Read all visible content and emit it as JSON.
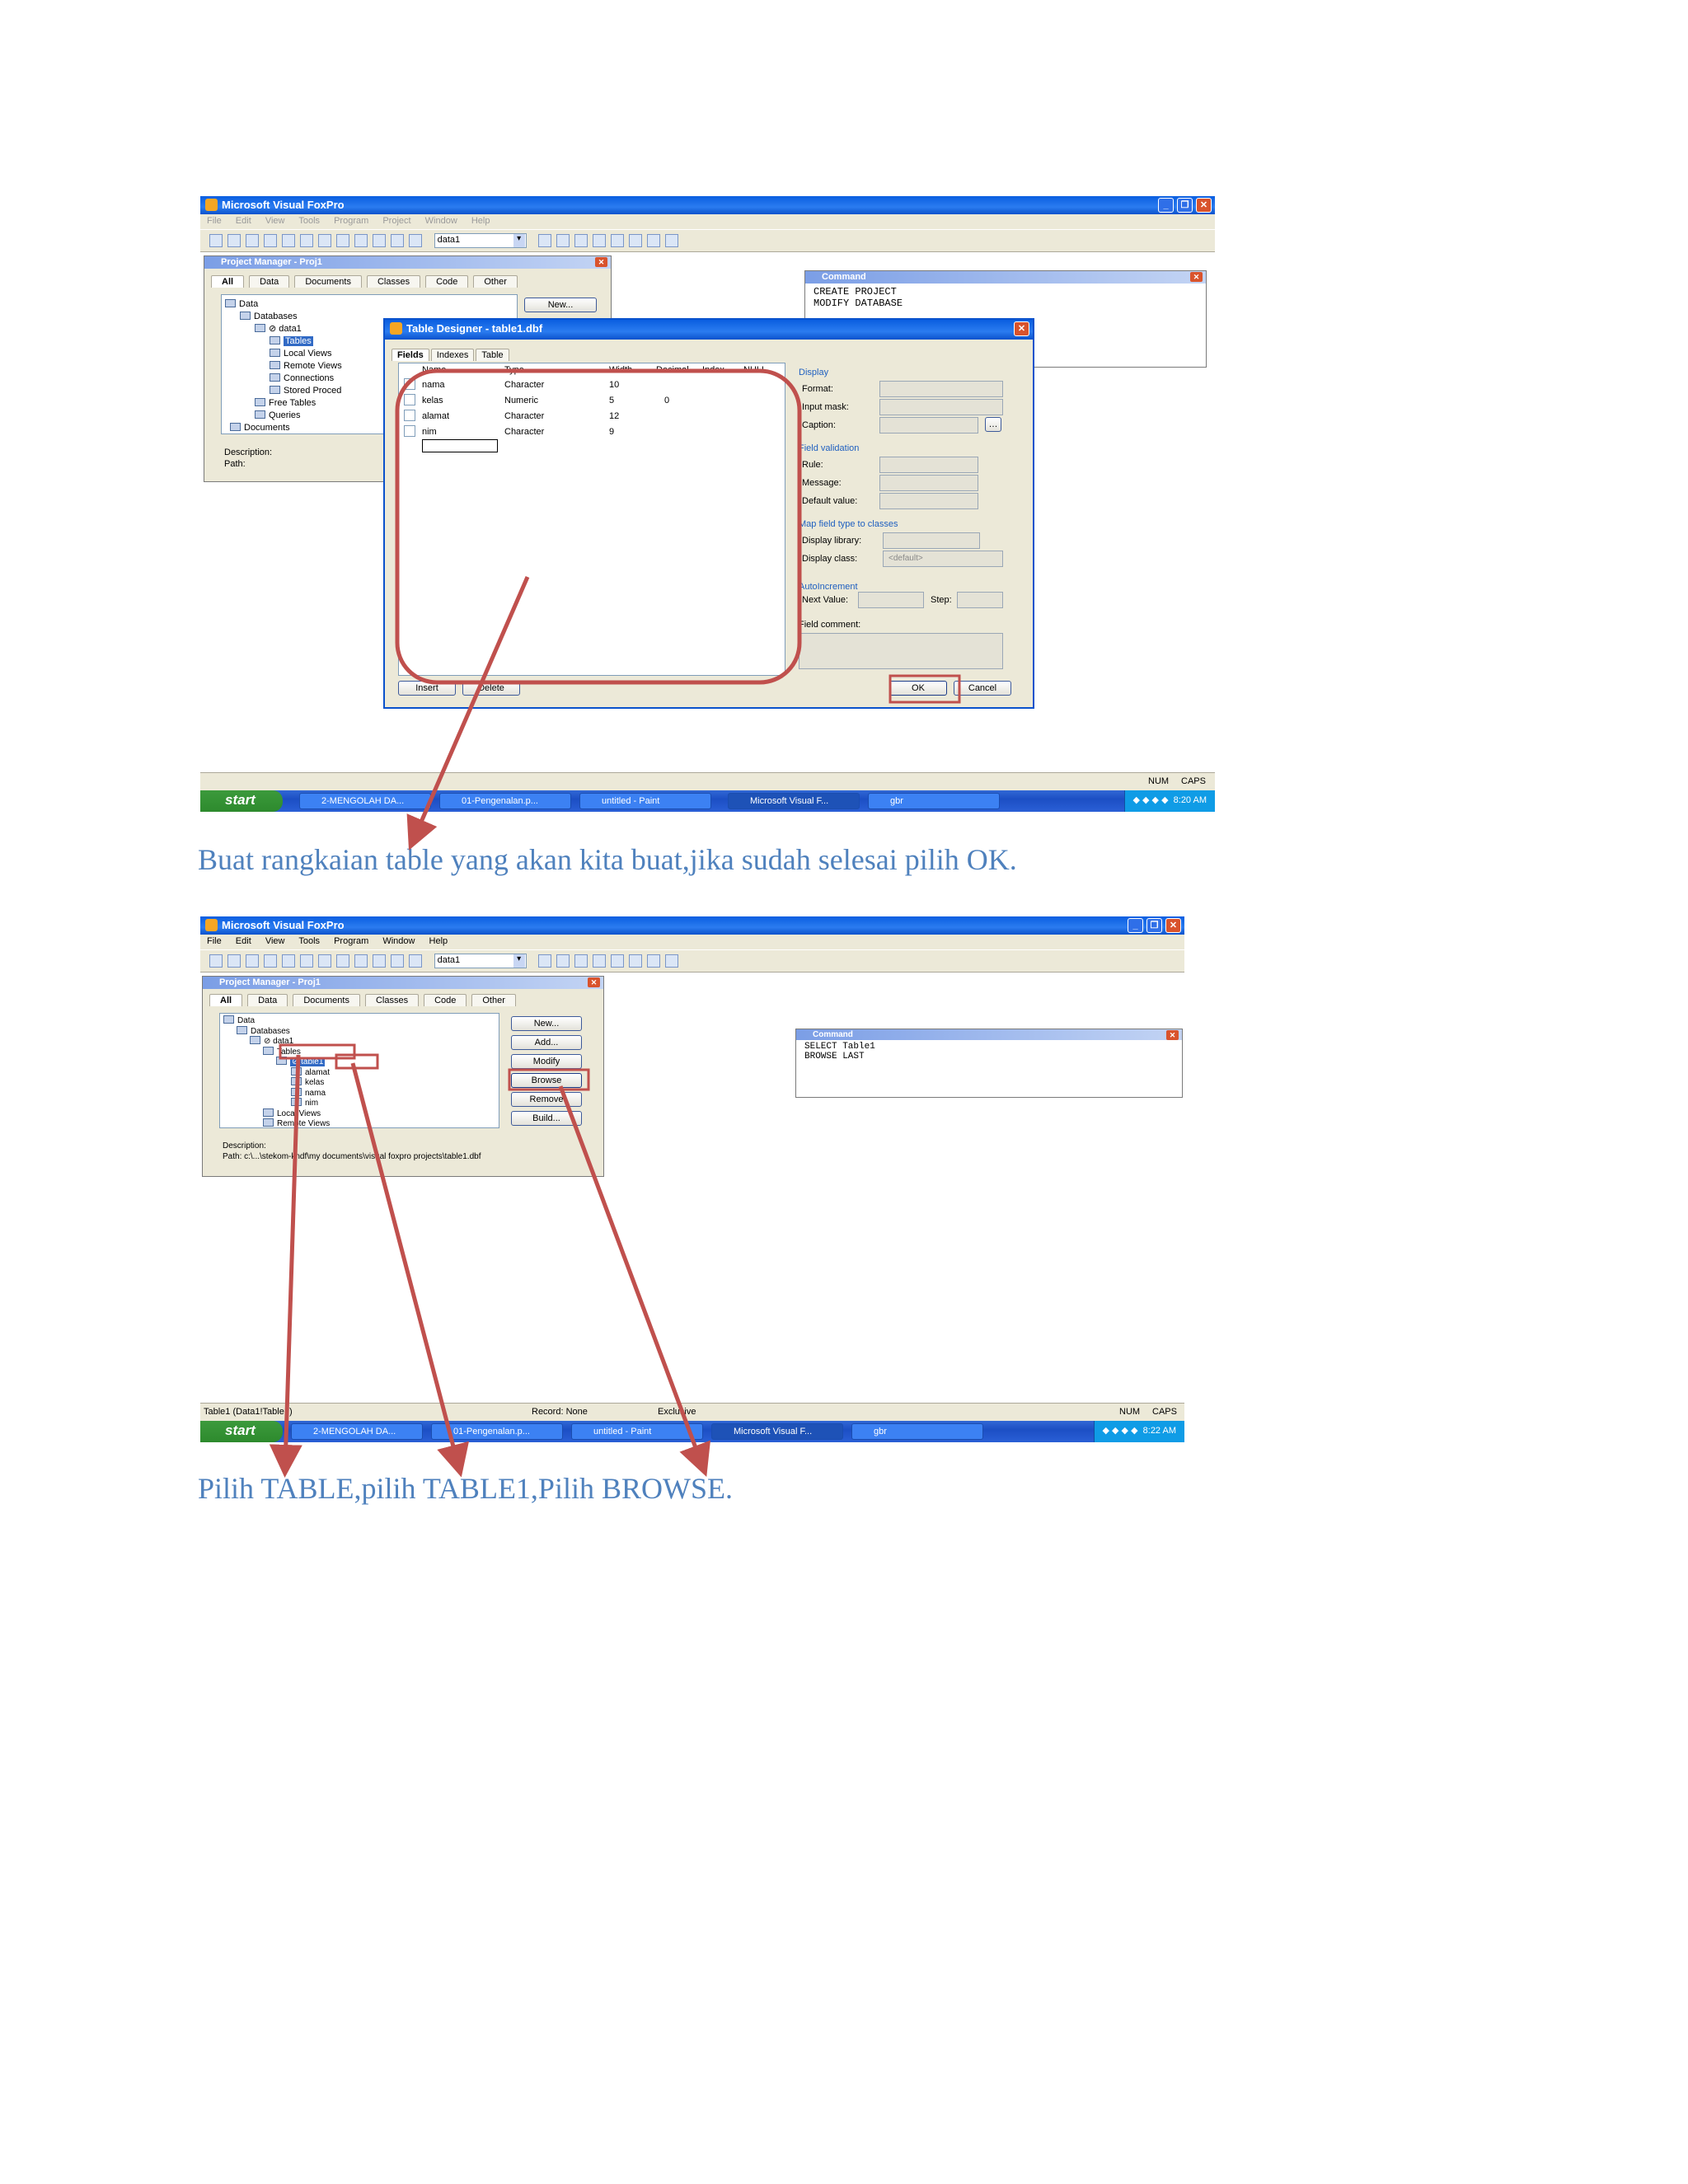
{
  "colors": {
    "annotation": "#c0504d",
    "caption": "#4f81bd",
    "titlebar": "#0a5ee0",
    "selection": "#316ac5"
  },
  "screenshot1": {
    "title": "Microsoft Visual FoxPro",
    "menu": [
      "File",
      "Edit",
      "View",
      "Tools",
      "Program",
      "Project",
      "Window",
      "Help"
    ],
    "toolbar_combo": "data1",
    "project_manager": {
      "title": "Project Manager - Proj1",
      "tabs": [
        "All",
        "Data",
        "Documents",
        "Classes",
        "Code",
        "Other"
      ],
      "tree": [
        "Data",
        "Databases",
        "⊘ data1",
        "Tables",
        "Local Views",
        "Remote Views",
        "Connections",
        "Stored Proced",
        "Free Tables",
        "Queries",
        "Documents"
      ],
      "new_button": "New...",
      "description_label": "Description:",
      "path_label": "Path:"
    },
    "command_window": {
      "title": "Command",
      "lines": [
        "CREATE PROJECT",
        "MODIFY DATABASE"
      ]
    },
    "table_designer": {
      "title": "Table Designer - table1.dbf",
      "tabs": [
        "Fields",
        "Indexes",
        "Table"
      ],
      "columns": [
        "Name",
        "Type",
        "Width",
        "Decimal",
        "Index",
        "NULL"
      ],
      "rows": [
        {
          "name": "nama",
          "type": "Character",
          "width": "10",
          "decimal": ""
        },
        {
          "name": "kelas",
          "type": "Numeric",
          "width": "5",
          "decimal": "0"
        },
        {
          "name": "alamat",
          "type": "Character",
          "width": "12",
          "decimal": ""
        },
        {
          "name": "nim",
          "type": "Character",
          "width": "9",
          "decimal": ""
        }
      ],
      "display_group": "Display",
      "format_label": "Format:",
      "input_mask_label": "Input mask:",
      "caption_label": "Caption:",
      "validation_group": "Field validation",
      "rule_label": "Rule:",
      "message_label": "Message:",
      "default_label": "Default value:",
      "map_group": "Map field type to classes",
      "display_library_label": "Display library:",
      "display_class_label": "Display class:",
      "display_class_value": "<default>",
      "autoinc_group": "AutoIncrement",
      "next_value_label": "Next Value:",
      "step_label": "Step:",
      "field_comment_label": "Field comment:",
      "insert_button": "Insert",
      "delete_button": "Delete",
      "ok_button": "OK",
      "cancel_button": "Cancel"
    },
    "status": {
      "num": "NUM",
      "caps": "CAPS"
    },
    "taskbar": {
      "start": "start",
      "tasks": [
        "2-MENGOLAH DA...",
        "01-Pengenalan.p...",
        "untitled - Paint",
        "Microsoft Visual F...",
        "gbr"
      ],
      "time": "8:20 AM"
    }
  },
  "caption1": "Buat rangkaian table yang akan kita buat,jika sudah selesai pilih OK.",
  "screenshot2": {
    "title": "Microsoft Visual FoxPro",
    "menu": [
      "File",
      "Edit",
      "View",
      "Tools",
      "Program",
      "Window",
      "Help"
    ],
    "toolbar_combo": "data1",
    "project_manager": {
      "title": "Project Manager - Proj1",
      "tabs": [
        "All",
        "Data",
        "Documents",
        "Classes",
        "Code",
        "Other"
      ],
      "tree": [
        "Data",
        "Databases",
        "⊘ data1",
        "Tables",
        "⊘ table1",
        "alamat",
        "kelas",
        "nama",
        "nim",
        "Local Views",
        "Remote Views"
      ],
      "buttons": [
        "New...",
        "Add...",
        "Modify",
        "Browse",
        "Remove",
        "Build..."
      ],
      "description_label": "Description:",
      "path": "Path: c:\\...\\stekom-kndf\\my documents\\visual foxpro projects\\table1.dbf"
    },
    "command_window": {
      "title": "Command",
      "lines": [
        "SELECT Table1",
        "BROWSE LAST"
      ]
    },
    "status": {
      "alias": "Table1 (Data1!Table1)",
      "record": "Record: None",
      "mode": "Exclusive",
      "num": "NUM",
      "caps": "CAPS"
    },
    "taskbar": {
      "start": "start",
      "tasks": [
        "2-MENGOLAH DA...",
        "01-Pengenalan.p...",
        "untitled - Paint",
        "Microsoft Visual F...",
        "gbr"
      ],
      "time": "8:22 AM"
    }
  },
  "caption2": "Pilih TABLE,pilih TABLE1,Pilih BROWSE."
}
